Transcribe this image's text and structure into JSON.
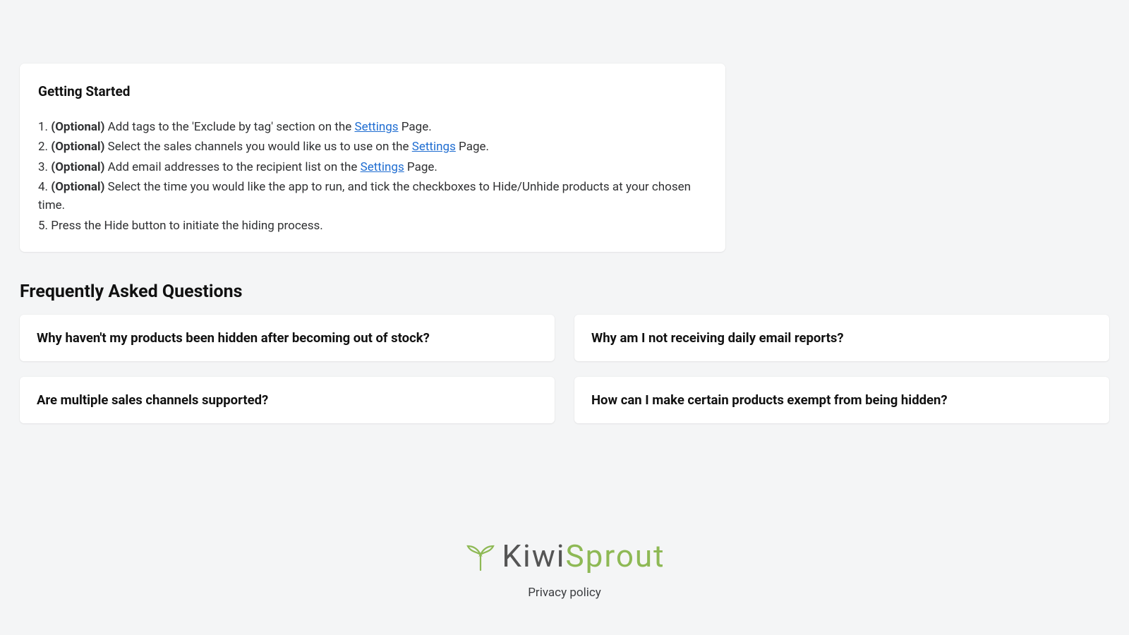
{
  "getting_started": {
    "title": "Getting Started",
    "link_text": "Settings",
    "steps": [
      {
        "num": "1.",
        "optional": "(Optional)",
        "before": " Add tags to the 'Exclude by tag' section on the ",
        "after": " Page.",
        "has_link": true
      },
      {
        "num": "2.",
        "optional": "(Optional)",
        "before": " Select the sales channels you would like us to use on the ",
        "after": " Page.",
        "has_link": true
      },
      {
        "num": "3.",
        "optional": "(Optional)",
        "before": " Add email addresses to the recipient list on the ",
        "after": " Page.",
        "has_link": true
      },
      {
        "num": "4.",
        "optional": "(Optional)",
        "before": " Select the time you would like the app to run, and tick the checkboxes to Hide/Unhide products at your chosen time.",
        "after": "",
        "has_link": false
      },
      {
        "num": "5.",
        "optional": "",
        "before": "Press the Hide button to initiate the hiding process.",
        "after": "",
        "has_link": false
      }
    ]
  },
  "faq": {
    "title": "Frequently Asked Questions",
    "items": [
      "Why haven't my products been hidden after becoming out of stock?",
      "Why am I not receiving daily email reports?",
      "Are multiple sales channels supported?",
      "How can I make certain products exempt from being hidden?"
    ]
  },
  "footer": {
    "brand_first": "Kiwi",
    "brand_second": "Sprout",
    "privacy": "Privacy policy"
  }
}
